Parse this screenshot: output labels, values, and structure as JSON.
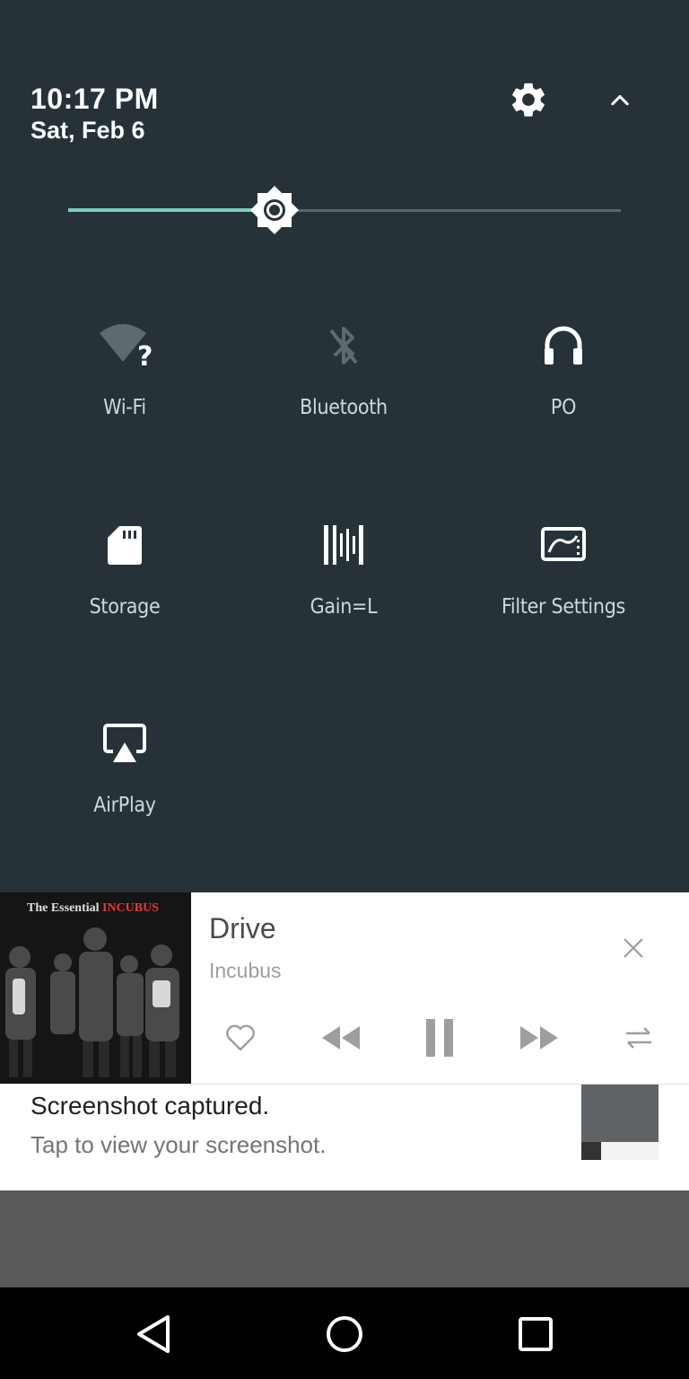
{
  "header": {
    "time": "10:17 PM",
    "date": "Sat, Feb 6"
  },
  "brightness": {
    "level": 0.374
  },
  "tiles": [
    {
      "label": "Wi-Fi",
      "icon": "wifi-unknown-icon"
    },
    {
      "label": "Bluetooth",
      "icon": "bluetooth-disabled-icon"
    },
    {
      "label": "PO",
      "icon": "headphones-icon"
    },
    {
      "label": "Storage",
      "icon": "sd-card-icon"
    },
    {
      "label": "Gain=L",
      "icon": "gain-bars-icon"
    },
    {
      "label": "Filter Settings",
      "icon": "filter-settings-icon"
    },
    {
      "label": "AirPlay",
      "icon": "airplay-icon"
    }
  ],
  "media": {
    "album_text_white": "The Essential ",
    "album_text_red": "INCUBUS",
    "title": "Drive",
    "artist": "Incubus"
  },
  "screenshot": {
    "title": "Screenshot captured.",
    "subtitle": "Tap to view your screenshot."
  },
  "colors": {
    "panel_bg": "#263238",
    "accent": "#80cbc4",
    "media_control": "#9e9e9e"
  }
}
